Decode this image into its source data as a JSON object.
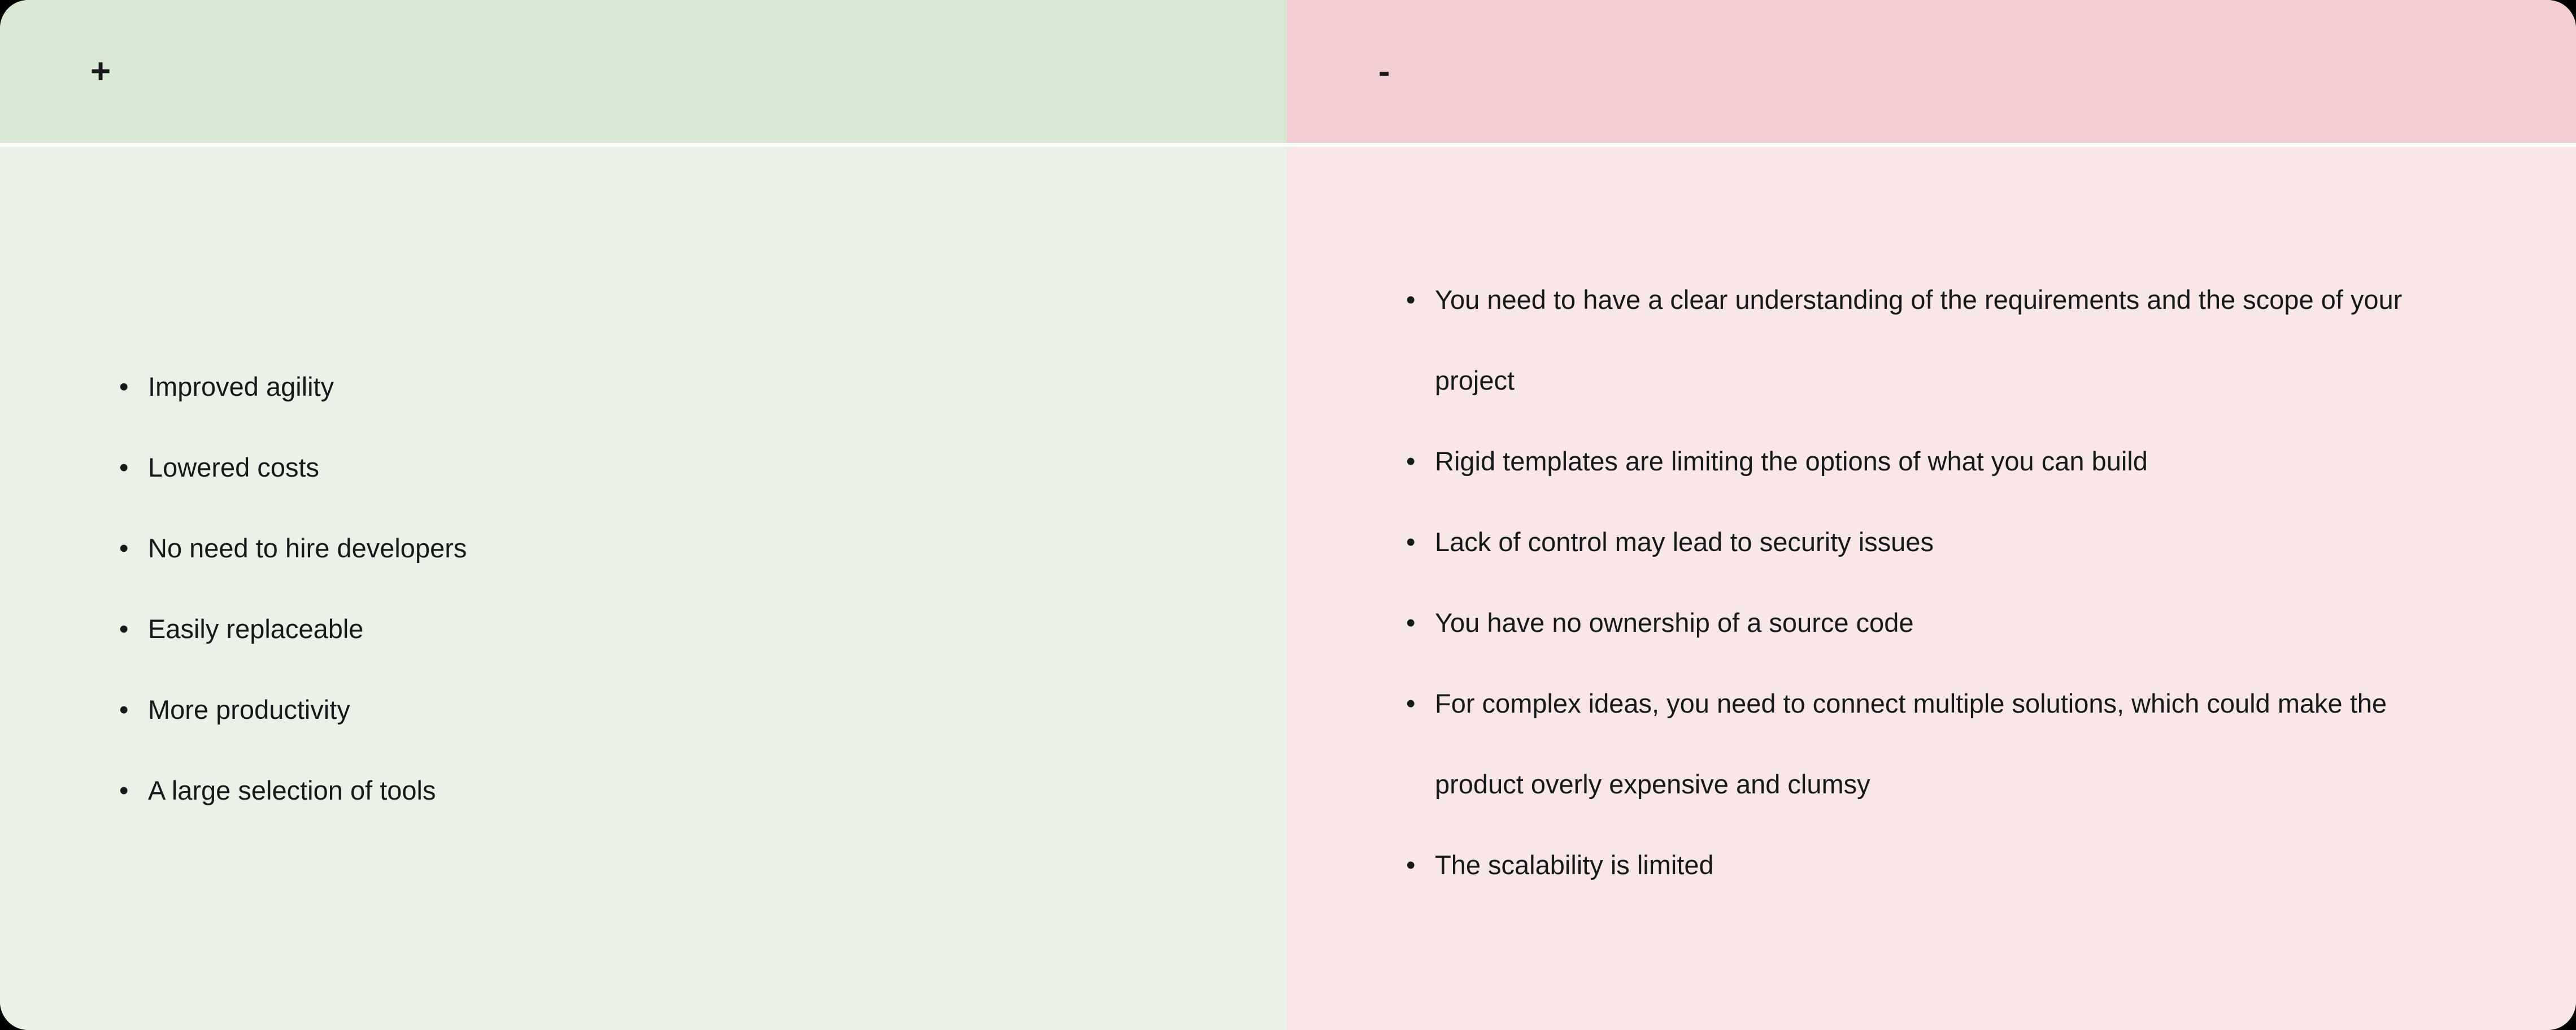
{
  "card": {
    "accent_pros_header_bg": "#d9e8d2",
    "accent_pros_body_bg": "#eaf2e8",
    "accent_cons_header_bg": "#f2cdd1",
    "accent_cons_body_bg": "#f9e6e7",
    "text_color": "#17181a"
  },
  "header": {
    "pros_symbol": "+",
    "cons_symbol": "-"
  },
  "pros": {
    "items": [
      "Improved agility",
      "Lowered costs",
      "No need to hire developers",
      "Easily replaceable",
      "More productivity",
      "A large selection of tools"
    ]
  },
  "cons": {
    "items": [
      "You need to have a clear understanding of the requirements and the scope of your project",
      "Rigid templates are limiting the options of what you can build",
      "Lack of control may lead to security issues",
      "You have no ownership of a source code",
      "For complex ideas, you need to connect multiple solutions, which could make the product overly expensive and clumsy",
      "The scalability is limited"
    ]
  },
  "bullet_glyph": "•"
}
